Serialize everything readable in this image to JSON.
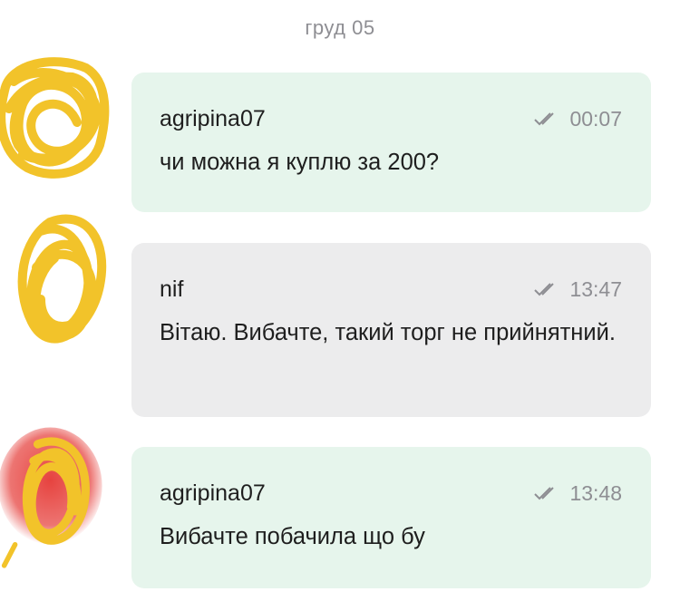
{
  "date_separator": "груд 05",
  "messages": [
    {
      "author": "agripina07",
      "time": "00:07",
      "text": "чи можна я куплю за 200?",
      "status_icon": "double-check-icon",
      "bubble_color": "#e6f5ec"
    },
    {
      "author": "nif",
      "time": "13:47",
      "text": "Вітаю. Вибачте, такий торг не прийнятний.",
      "status_icon": "double-check-icon",
      "bubble_color": "#ececed"
    },
    {
      "author": "agripina07",
      "time": "13:48",
      "text": "Вибачте побачила що бу",
      "status_icon": "double-check-icon",
      "bubble_color": "#e6f5ec"
    }
  ],
  "colors": {
    "scribble": "#f2c32a",
    "redaction_red": "#e53935",
    "meta": "#8e8e93"
  }
}
